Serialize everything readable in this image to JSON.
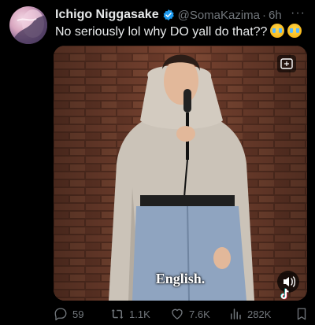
{
  "author": {
    "display_name": "Ichigo Niggasake",
    "handle": "@SomaKazima",
    "separator": "·",
    "time": "6h",
    "verified": true
  },
  "tweet": {
    "text": "No seriously lol why DO yall do that??",
    "emojis": [
      "crying-laughing-emoji",
      "crying-laughing-emoji"
    ]
  },
  "media": {
    "caption": "English.",
    "icons": [
      "gif-icon",
      "sound-icon",
      "tiktok-icon"
    ]
  },
  "actions": {
    "replies": "59",
    "retweets": "1.1K",
    "likes": "7.6K",
    "views": "282K"
  },
  "colors": {
    "background": "#000000",
    "text": "#e7e9ea",
    "muted": "#71767b",
    "verified": "#1d9bf0",
    "brick": "#6b3b2a"
  }
}
